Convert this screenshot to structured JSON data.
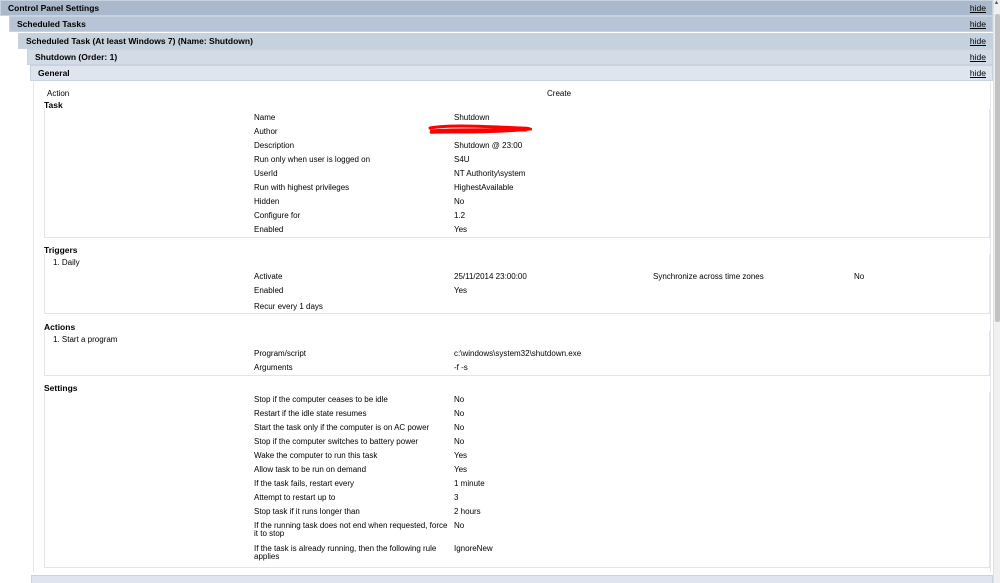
{
  "bars": {
    "control_panel": "Control Panel Settings",
    "scheduled_tasks": "Scheduled Tasks",
    "task": "Scheduled Task (At least Windows 7) (Name: Shutdown)",
    "shutdown": "Shutdown (Order: 1)",
    "general": "General",
    "hide": "hide"
  },
  "action": {
    "label": "Action",
    "value": "Create"
  },
  "task": {
    "heading": "Task",
    "rows": [
      {
        "label": "Name",
        "value": "Shutdown"
      },
      {
        "label": "Author",
        "value": ""
      },
      {
        "label": "Description",
        "value": "Shutdown @ 23:00"
      },
      {
        "label": "Run only when user is logged on",
        "value": "S4U"
      },
      {
        "label": "UserId",
        "value": "NT Authority\\system"
      },
      {
        "label": "Run with highest privileges",
        "value": "HighestAvailable"
      },
      {
        "label": "Hidden",
        "value": "No"
      },
      {
        "label": "Configure for",
        "value": "1.2"
      },
      {
        "label": "Enabled",
        "value": "Yes"
      }
    ]
  },
  "triggers": {
    "heading": "Triggers",
    "item": "1. Daily",
    "activate_label": "Activate",
    "activate_value": "25/11/2014 23:00:00",
    "sync_label": "Synchronize across time zones",
    "sync_value": "No",
    "enabled_label": "Enabled",
    "enabled_value": "Yes",
    "recur": "Recur every 1 days"
  },
  "actions": {
    "heading": "Actions",
    "item": "1. Start a program",
    "program_label": "Program/script",
    "program_value": "c:\\windows\\system32\\shutdown.exe",
    "args_label": "Arguments",
    "args_value": "-f -s"
  },
  "settings": {
    "heading": "Settings",
    "rows": [
      {
        "label": "Stop if the computer ceases to be idle",
        "value": "No"
      },
      {
        "label": "Restart if the idle state resumes",
        "value": "No"
      },
      {
        "label": "Start the task only if the computer is on AC power",
        "value": "No"
      },
      {
        "label": "Stop if the computer switches to battery power",
        "value": "No"
      },
      {
        "label": "Wake the computer to run this task",
        "value": "Yes"
      },
      {
        "label": "Allow task to be run on demand",
        "value": "Yes"
      },
      {
        "label": "If the task fails, restart every",
        "value": "1 minute"
      },
      {
        "label": "Attempt to restart up to",
        "value": "3"
      },
      {
        "label": "Stop task if it runs longer than",
        "value": "2 hours"
      },
      {
        "label": "If the running task does not end when requested, force",
        "label2": "it to stop",
        "value": "No"
      },
      {
        "label": "If the task is already running, then the following rule",
        "label2": "applies",
        "value": "IgnoreNew"
      }
    ]
  },
  "colors": {
    "bar1": "#a9b8cb",
    "bar2": "#b7c4d5",
    "redaction": "#ff0000"
  }
}
